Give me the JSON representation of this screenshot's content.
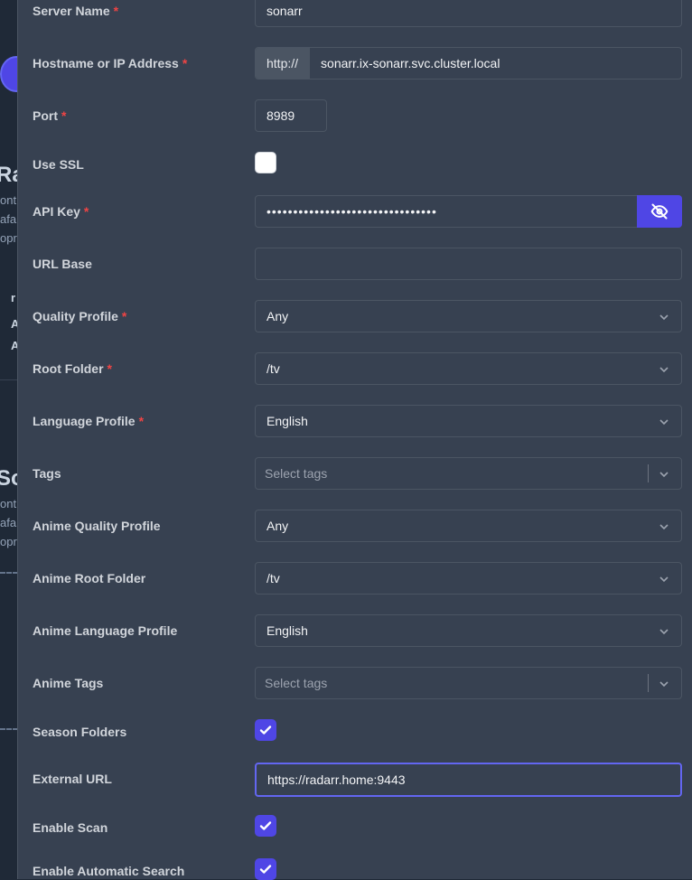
{
  "background": {
    "frag1": "Ra",
    "frag2": "So",
    "snip1": "ont",
    "snip2": "afa",
    "snip3": "opr",
    "snip4": "ont",
    "snip5": "afa",
    "snip6": "opr",
    "letter1": "r",
    "letter2": "A",
    "letter3": "A"
  },
  "form": {
    "server_name": {
      "label": "Server Name",
      "value": "sonarr"
    },
    "hostname": {
      "label": "Hostname or IP Address",
      "prefix": "http://",
      "value": "sonarr.ix-sonarr.svc.cluster.local"
    },
    "port": {
      "label": "Port",
      "value": "8989"
    },
    "use_ssl": {
      "label": "Use SSL",
      "checked": false
    },
    "api_key": {
      "label": "API Key",
      "value": "••••••••••••••••••••••••••••••••",
      "toggle_icon": "eye-off-icon"
    },
    "url_base": {
      "label": "URL Base",
      "value": ""
    },
    "quality_profile": {
      "label": "Quality Profile",
      "value": "Any"
    },
    "root_folder": {
      "label": "Root Folder",
      "value": "/tv"
    },
    "language_profile": {
      "label": "Language Profile",
      "value": "English"
    },
    "tags": {
      "label": "Tags",
      "placeholder": "Select tags"
    },
    "anime_quality_profile": {
      "label": "Anime Quality Profile",
      "value": "Any"
    },
    "anime_root_folder": {
      "label": "Anime Root Folder",
      "value": "/tv"
    },
    "anime_language_profile": {
      "label": "Anime Language Profile",
      "value": "English"
    },
    "anime_tags": {
      "label": "Anime Tags",
      "placeholder": "Select tags"
    },
    "season_folders": {
      "label": "Season Folders",
      "checked": true
    },
    "external_url": {
      "label": "External URL",
      "value": "https://radarr.home:9443"
    },
    "enable_scan": {
      "label": "Enable Scan",
      "checked": true
    },
    "enable_auto_search": {
      "label": "Enable Automatic Search",
      "checked": true
    }
  },
  "required_marker": "*",
  "colors": {
    "accent": "#4f46e5",
    "required": "#ef4444",
    "panel": "#374151"
  }
}
